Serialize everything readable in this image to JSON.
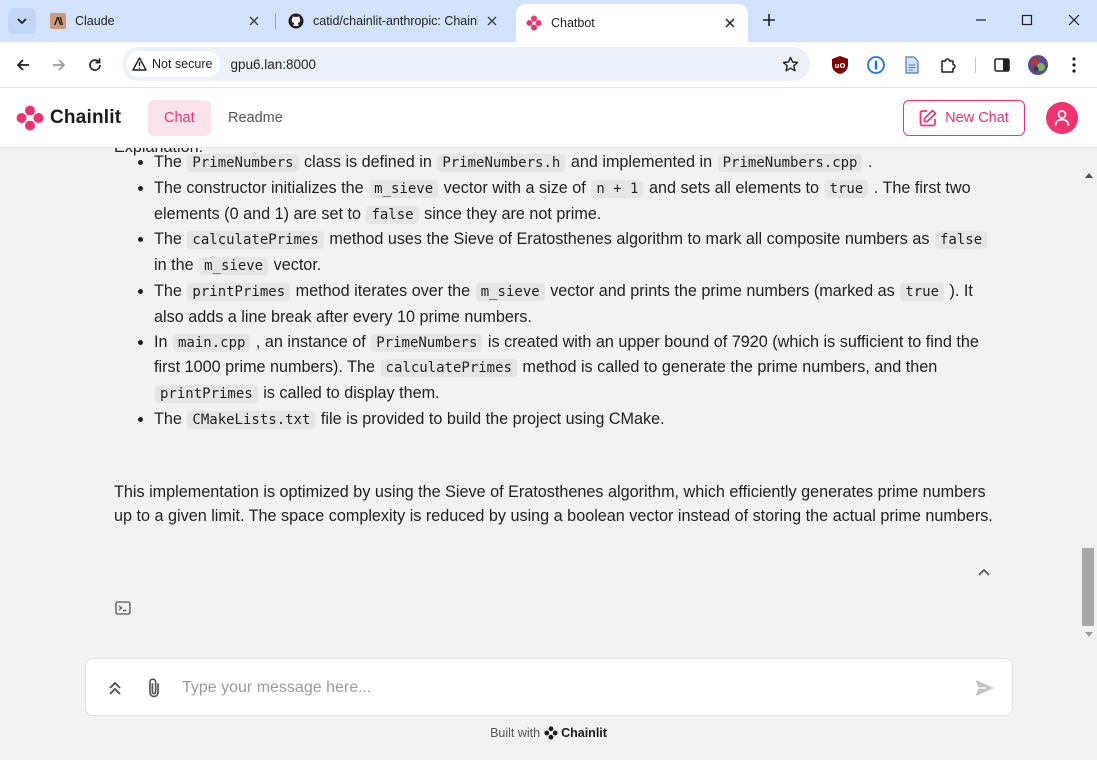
{
  "browser": {
    "tabs": [
      {
        "title": "Claude",
        "icon": "anthropic-icon",
        "active": false
      },
      {
        "title": "catid/chainlit-anthropic: Chainlit",
        "icon": "github-icon",
        "active": false
      },
      {
        "title": "Chatbot",
        "icon": "chainlit-icon",
        "active": true
      }
    ],
    "security_label": "Not secure",
    "url": "gpu6.lan:8000"
  },
  "app": {
    "brand": "Chainlit",
    "nav": {
      "chat": "Chat",
      "readme": "Readme"
    },
    "new_chat": "New Chat",
    "accent": "#f0336f"
  },
  "message": {
    "cut_heading": "Explanation:",
    "bullets": [
      [
        {
          "t": "The "
        },
        {
          "c": "PrimeNumbers"
        },
        {
          "t": " class is defined in "
        },
        {
          "c": "PrimeNumbers.h"
        },
        {
          "t": " and implemented in "
        },
        {
          "c": "PrimeNumbers.cpp"
        },
        {
          "t": " ."
        }
      ],
      [
        {
          "t": "The constructor initializes the "
        },
        {
          "c": "m_sieve"
        },
        {
          "t": " vector with a size of "
        },
        {
          "c": "n + 1"
        },
        {
          "t": " and sets all elements to "
        },
        {
          "c": "true"
        },
        {
          "t": " . The first two elements (0 and 1) are set to "
        },
        {
          "c": "false"
        },
        {
          "t": " since they are not prime."
        }
      ],
      [
        {
          "t": "The "
        },
        {
          "c": "calculatePrimes"
        },
        {
          "t": " method uses the Sieve of Eratosthenes algorithm to mark all composite numbers as "
        },
        {
          "c": "false"
        },
        {
          "t": " in the "
        },
        {
          "c": "m_sieve"
        },
        {
          "t": " vector."
        }
      ],
      [
        {
          "t": "The "
        },
        {
          "c": "printPrimes"
        },
        {
          "t": " method iterates over the "
        },
        {
          "c": "m_sieve"
        },
        {
          "t": " vector and prints the prime numbers (marked as "
        },
        {
          "c": "true"
        },
        {
          "t": " ). It also adds a line break after every 10 prime numbers."
        }
      ],
      [
        {
          "t": "In "
        },
        {
          "c": "main.cpp"
        },
        {
          "t": " , an instance of "
        },
        {
          "c": "PrimeNumbers"
        },
        {
          "t": " is created with an upper bound of 7920 (which is sufficient to find the first 1000 prime numbers). The "
        },
        {
          "c": "calculatePrimes"
        },
        {
          "t": " method is called to generate the prime numbers, and then "
        },
        {
          "c": "printPrimes"
        },
        {
          "t": " is called to display them."
        }
      ],
      [
        {
          "t": "The "
        },
        {
          "c": "CMakeLists.txt"
        },
        {
          "t": " file is provided to build the project using CMake."
        }
      ]
    ],
    "summary": "This implementation is optimized by using the Sieve of Eratosthenes algorithm, which efficiently generates prime numbers up to a given limit. The space complexity is reduced by using a boolean vector instead of storing the actual prime numbers."
  },
  "composer": {
    "placeholder": "Type your message here..."
  },
  "footer": {
    "built_with": "Built with",
    "brand": "Chainlit"
  }
}
